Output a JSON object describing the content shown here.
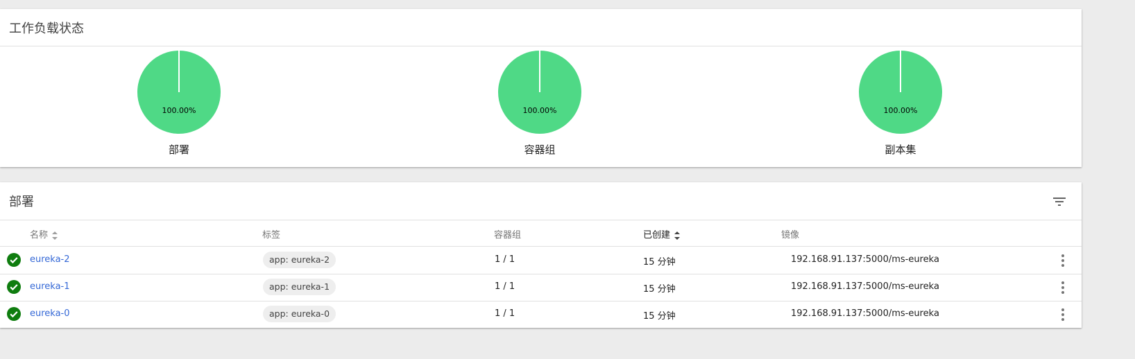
{
  "status_card": {
    "title": "工作负载状态",
    "pies": [
      {
        "label": "部署",
        "percent": "100.00%",
        "value": 100,
        "color": "#4fd986"
      },
      {
        "label": "容器组",
        "percent": "100.00%",
        "value": 100,
        "color": "#4fd986"
      },
      {
        "label": "副本集",
        "percent": "100.00%",
        "value": 100,
        "color": "#4fd986"
      }
    ]
  },
  "deploy_card": {
    "title": "部署",
    "filter_icon": "filter-icon",
    "columns": {
      "name": "名称",
      "labels": "标签",
      "pods": "容器组",
      "created": "已创建",
      "image": "镜像"
    },
    "rows": [
      {
        "status": "ok",
        "name": "eureka-2",
        "label": "app: eureka-2",
        "pods": "1 / 1",
        "created": "15 分钟",
        "image": "192.168.91.137:5000/ms-eureka"
      },
      {
        "status": "ok",
        "name": "eureka-1",
        "label": "app: eureka-1",
        "pods": "1 / 1",
        "created": "15 分钟",
        "image": "192.168.91.137:5000/ms-eureka"
      },
      {
        "status": "ok",
        "name": "eureka-0",
        "label": "app: eureka-0",
        "pods": "1 / 1",
        "created": "15 分钟",
        "image": "192.168.91.137:5000/ms-eureka"
      }
    ],
    "status_color": "#0f9d58"
  }
}
